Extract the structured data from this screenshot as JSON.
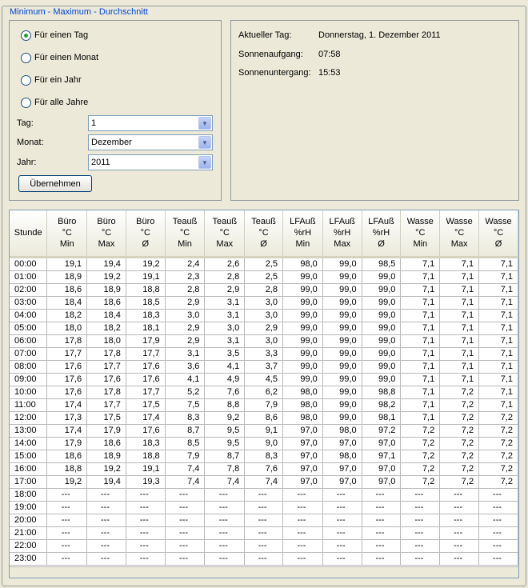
{
  "group_title": "Minimum - Maximum - Durchschnitt",
  "period_options": [
    {
      "label": "Für einen Tag",
      "selected": true
    },
    {
      "label": "Für einen Monat",
      "selected": false
    },
    {
      "label": "Für ein Jahr",
      "selected": false
    },
    {
      "label": "Für alle Jahre",
      "selected": false
    }
  ],
  "fields": {
    "tag_label": "Tag:",
    "tag_value": "1",
    "monat_label": "Monat:",
    "monat_value": "Dezember",
    "jahr_label": "Jahr:",
    "jahr_value": "2011"
  },
  "apply_label": "Übernehmen",
  "info": {
    "day_label": "Aktueller Tag:",
    "day_value": "Donnerstag, 1. Dezember 2011",
    "sunrise_label": "Sonnenaufgang:",
    "sunrise_value": "07:58",
    "sunset_label": "Sonnenuntergang:",
    "sunset_value": "15:53"
  },
  "table": {
    "headers": [
      [
        "Stunde"
      ],
      [
        "Büro",
        "°C",
        "Min"
      ],
      [
        "Büro",
        "°C",
        "Max"
      ],
      [
        "Büro",
        "°C",
        "Ø"
      ],
      [
        "Teauß",
        "°C",
        "Min"
      ],
      [
        "Teauß",
        "°C",
        "Max"
      ],
      [
        "Teauß",
        "°C",
        "Ø"
      ],
      [
        "LFAuß",
        "%rH",
        "Min"
      ],
      [
        "LFAuß",
        "%rH",
        "Max"
      ],
      [
        "LFAuß",
        "%rH",
        "Ø"
      ],
      [
        "Wasse",
        "°C",
        "Min"
      ],
      [
        "Wasse",
        "°C",
        "Max"
      ],
      [
        "Wasse",
        "°C",
        "Ø"
      ]
    ],
    "rows": [
      [
        "00:00",
        "19,1",
        "19,4",
        "19,2",
        "2,4",
        "2,6",
        "2,5",
        "98,0",
        "99,0",
        "98,5",
        "7,1",
        "7,1",
        "7,1"
      ],
      [
        "01:00",
        "18,9",
        "19,2",
        "19,1",
        "2,3",
        "2,8",
        "2,5",
        "99,0",
        "99,0",
        "99,0",
        "7,1",
        "7,1",
        "7,1"
      ],
      [
        "02:00",
        "18,6",
        "18,9",
        "18,8",
        "2,8",
        "2,9",
        "2,8",
        "99,0",
        "99,0",
        "99,0",
        "7,1",
        "7,1",
        "7,1"
      ],
      [
        "03:00",
        "18,4",
        "18,6",
        "18,5",
        "2,9",
        "3,1",
        "3,0",
        "99,0",
        "99,0",
        "99,0",
        "7,1",
        "7,1",
        "7,1"
      ],
      [
        "04:00",
        "18,2",
        "18,4",
        "18,3",
        "3,0",
        "3,1",
        "3,0",
        "99,0",
        "99,0",
        "99,0",
        "7,1",
        "7,1",
        "7,1"
      ],
      [
        "05:00",
        "18,0",
        "18,2",
        "18,1",
        "2,9",
        "3,0",
        "2,9",
        "99,0",
        "99,0",
        "99,0",
        "7,1",
        "7,1",
        "7,1"
      ],
      [
        "06:00",
        "17,8",
        "18,0",
        "17,9",
        "2,9",
        "3,1",
        "3,0",
        "99,0",
        "99,0",
        "99,0",
        "7,1",
        "7,1",
        "7,1"
      ],
      [
        "07:00",
        "17,7",
        "17,8",
        "17,7",
        "3,1",
        "3,5",
        "3,3",
        "99,0",
        "99,0",
        "99,0",
        "7,1",
        "7,1",
        "7,1"
      ],
      [
        "08:00",
        "17,6",
        "17,7",
        "17,6",
        "3,6",
        "4,1",
        "3,7",
        "99,0",
        "99,0",
        "99,0",
        "7,1",
        "7,1",
        "7,1"
      ],
      [
        "09:00",
        "17,6",
        "17,6",
        "17,6",
        "4,1",
        "4,9",
        "4,5",
        "99,0",
        "99,0",
        "99,0",
        "7,1",
        "7,1",
        "7,1"
      ],
      [
        "10:00",
        "17,6",
        "17,8",
        "17,7",
        "5,2",
        "7,6",
        "6,2",
        "98,0",
        "99,0",
        "98,8",
        "7,1",
        "7,2",
        "7,1"
      ],
      [
        "11:00",
        "17,4",
        "17,7",
        "17,5",
        "7,5",
        "8,8",
        "7,9",
        "98,0",
        "99,0",
        "98,2",
        "7,1",
        "7,2",
        "7,1"
      ],
      [
        "12:00",
        "17,3",
        "17,5",
        "17,4",
        "8,3",
        "9,2",
        "8,6",
        "98,0",
        "99,0",
        "98,1",
        "7,1",
        "7,2",
        "7,2"
      ],
      [
        "13:00",
        "17,4",
        "17,9",
        "17,6",
        "8,7",
        "9,5",
        "9,1",
        "97,0",
        "98,0",
        "97,2",
        "7,2",
        "7,2",
        "7,2"
      ],
      [
        "14:00",
        "17,9",
        "18,6",
        "18,3",
        "8,5",
        "9,5",
        "9,0",
        "97,0",
        "97,0",
        "97,0",
        "7,2",
        "7,2",
        "7,2"
      ],
      [
        "15:00",
        "18,6",
        "18,9",
        "18,8",
        "7,9",
        "8,7",
        "8,3",
        "97,0",
        "98,0",
        "97,1",
        "7,2",
        "7,2",
        "7,2"
      ],
      [
        "16:00",
        "18,8",
        "19,2",
        "19,1",
        "7,4",
        "7,8",
        "7,6",
        "97,0",
        "97,0",
        "97,0",
        "7,2",
        "7,2",
        "7,2"
      ],
      [
        "17:00",
        "19,2",
        "19,4",
        "19,3",
        "7,4",
        "7,4",
        "7,4",
        "97,0",
        "97,0",
        "97,0",
        "7,2",
        "7,2",
        "7,2"
      ],
      [
        "18:00",
        "---",
        "---",
        "---",
        "---",
        "---",
        "---",
        "---",
        "---",
        "---",
        "---",
        "---",
        "---"
      ],
      [
        "19:00",
        "---",
        "---",
        "---",
        "---",
        "---",
        "---",
        "---",
        "---",
        "---",
        "---",
        "---",
        "---"
      ],
      [
        "20:00",
        "---",
        "---",
        "---",
        "---",
        "---",
        "---",
        "---",
        "---",
        "---",
        "---",
        "---",
        "---"
      ],
      [
        "21:00",
        "---",
        "---",
        "---",
        "---",
        "---",
        "---",
        "---",
        "---",
        "---",
        "---",
        "---",
        "---"
      ],
      [
        "22:00",
        "---",
        "---",
        "---",
        "---",
        "---",
        "---",
        "---",
        "---",
        "---",
        "---",
        "---",
        "---"
      ],
      [
        "23:00",
        "---",
        "---",
        "---",
        "---",
        "---",
        "---",
        "---",
        "---",
        "---",
        "---",
        "---",
        "---"
      ]
    ]
  }
}
